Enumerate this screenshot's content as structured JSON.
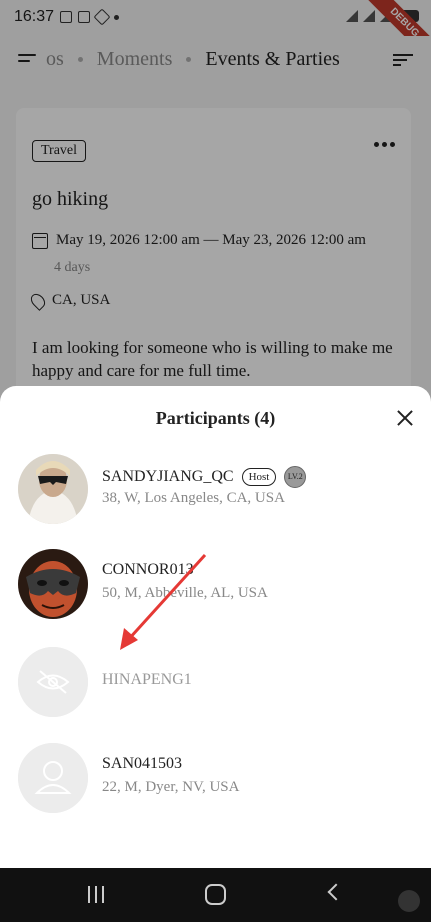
{
  "status_bar": {
    "time": "16:37",
    "debug_label": "DEBUG"
  },
  "nav": {
    "tabs": [
      "os",
      "Moments",
      "Events & Parties"
    ],
    "active_tab": "Events & Parties"
  },
  "event": {
    "category": "Travel",
    "title": "go hiking",
    "date_range": "May 19, 2026 12:00 am — May 23, 2026 12:00 am",
    "duration": "4 days",
    "location": "CA, USA",
    "description": "I am looking for someone who is willing to make me happy and care for me full time."
  },
  "sheet": {
    "title": "Participants (4)",
    "participants": [
      {
        "name": "SANDYJIANG_QC",
        "info": "38, W, Los Angeles, CA, USA",
        "host_label": "Host",
        "level_label": "LV.2"
      },
      {
        "name": "CONNOR013",
        "info": "50, M, Abbeville, AL, USA"
      },
      {
        "name": "HINAPENG1",
        "info": ""
      },
      {
        "name": "SAN041503",
        "info": "22, M, Dyer, NV, USA"
      }
    ]
  },
  "colors": {
    "accent_red": "#e53935",
    "overlay": "#000000"
  }
}
